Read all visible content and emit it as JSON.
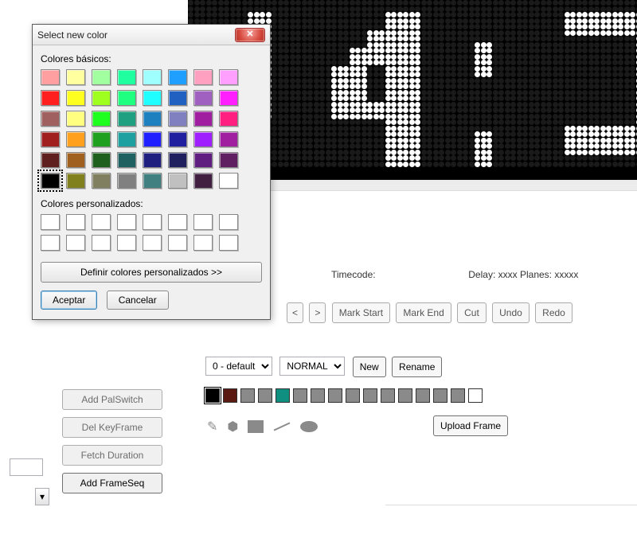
{
  "led_display_text": "14:",
  "info": {
    "timecode_label": "Timecode:",
    "delay_label": "Delay:",
    "delay_value": "xxxx",
    "planes_label": "Planes:",
    "planes_value": "xxxxx"
  },
  "nav": {
    "prev": "<",
    "next": ">",
    "mark_start": "Mark Start",
    "mark_end": "Mark End",
    "cut": "Cut",
    "undo": "Undo",
    "redo": "Redo"
  },
  "modes": {
    "palette_select": "0 - default",
    "blend_select": "NORMAL",
    "new": "New",
    "rename": "Rename"
  },
  "side": {
    "add_palswitch": "Add PalSwitch",
    "del_keyframe": "Del KeyFrame",
    "fetch_duration": "Fetch Duration",
    "add_frameseq": "Add FrameSeq"
  },
  "upload_frame": "Upload Frame",
  "palette_colors": [
    "#000000",
    "#5a1a12",
    "#8a8a8a",
    "#8a8a8a",
    "#0e8f7f",
    "#8a8a8a",
    "#8a8a8a",
    "#8a8a8a",
    "#8a8a8a",
    "#8a8a8a",
    "#8a8a8a",
    "#8a8a8a",
    "#8a8a8a",
    "#8a8a8a",
    "#8a8a8a",
    "#ffffff"
  ],
  "dialog": {
    "title": "Select new color",
    "basic_label": "Colores básicos:",
    "custom_label": "Colores personalizados:",
    "define": "Definir colores personalizados >>",
    "accept": "Aceptar",
    "cancel": "Cancelar",
    "selected_index": 40,
    "basic_colors": [
      "#ff9f9f",
      "#ffffa0",
      "#a2ff9f",
      "#1fff9f",
      "#9fffff",
      "#1f9fff",
      "#ffa0c0",
      "#ff9fff",
      "#ff1f1f",
      "#ffff1f",
      "#9fff1f",
      "#1fff80",
      "#1fffff",
      "#2060c0",
      "#a060c0",
      "#ff1fff",
      "#a06060",
      "#ffff80",
      "#1fff1f",
      "#1fa080",
      "#1f80c0",
      "#8080c0",
      "#a01fa0",
      "#ff1f80",
      "#a01f1f",
      "#ffa01f",
      "#1fa01f",
      "#1fa0a0",
      "#1f1fff",
      "#1f1fa0",
      "#a01fff",
      "#a01fa0",
      "#601f1f",
      "#a0601f",
      "#1f601f",
      "#1f6060",
      "#1f1f80",
      "#1f1f60",
      "#601f80",
      "#601f60",
      "#000000",
      "#80801f",
      "#808060",
      "#808080",
      "#408080",
      "#c0c0c0",
      "#401f40",
      "#ffffff"
    ]
  },
  "chart_data": {
    "type": "led-matrix",
    "text": "14:",
    "dot_color": "#ffffff",
    "bg_color": "#000000",
    "note": "partial view of LED dot-matrix clock showing '14:' with more digits cut off to the right"
  }
}
